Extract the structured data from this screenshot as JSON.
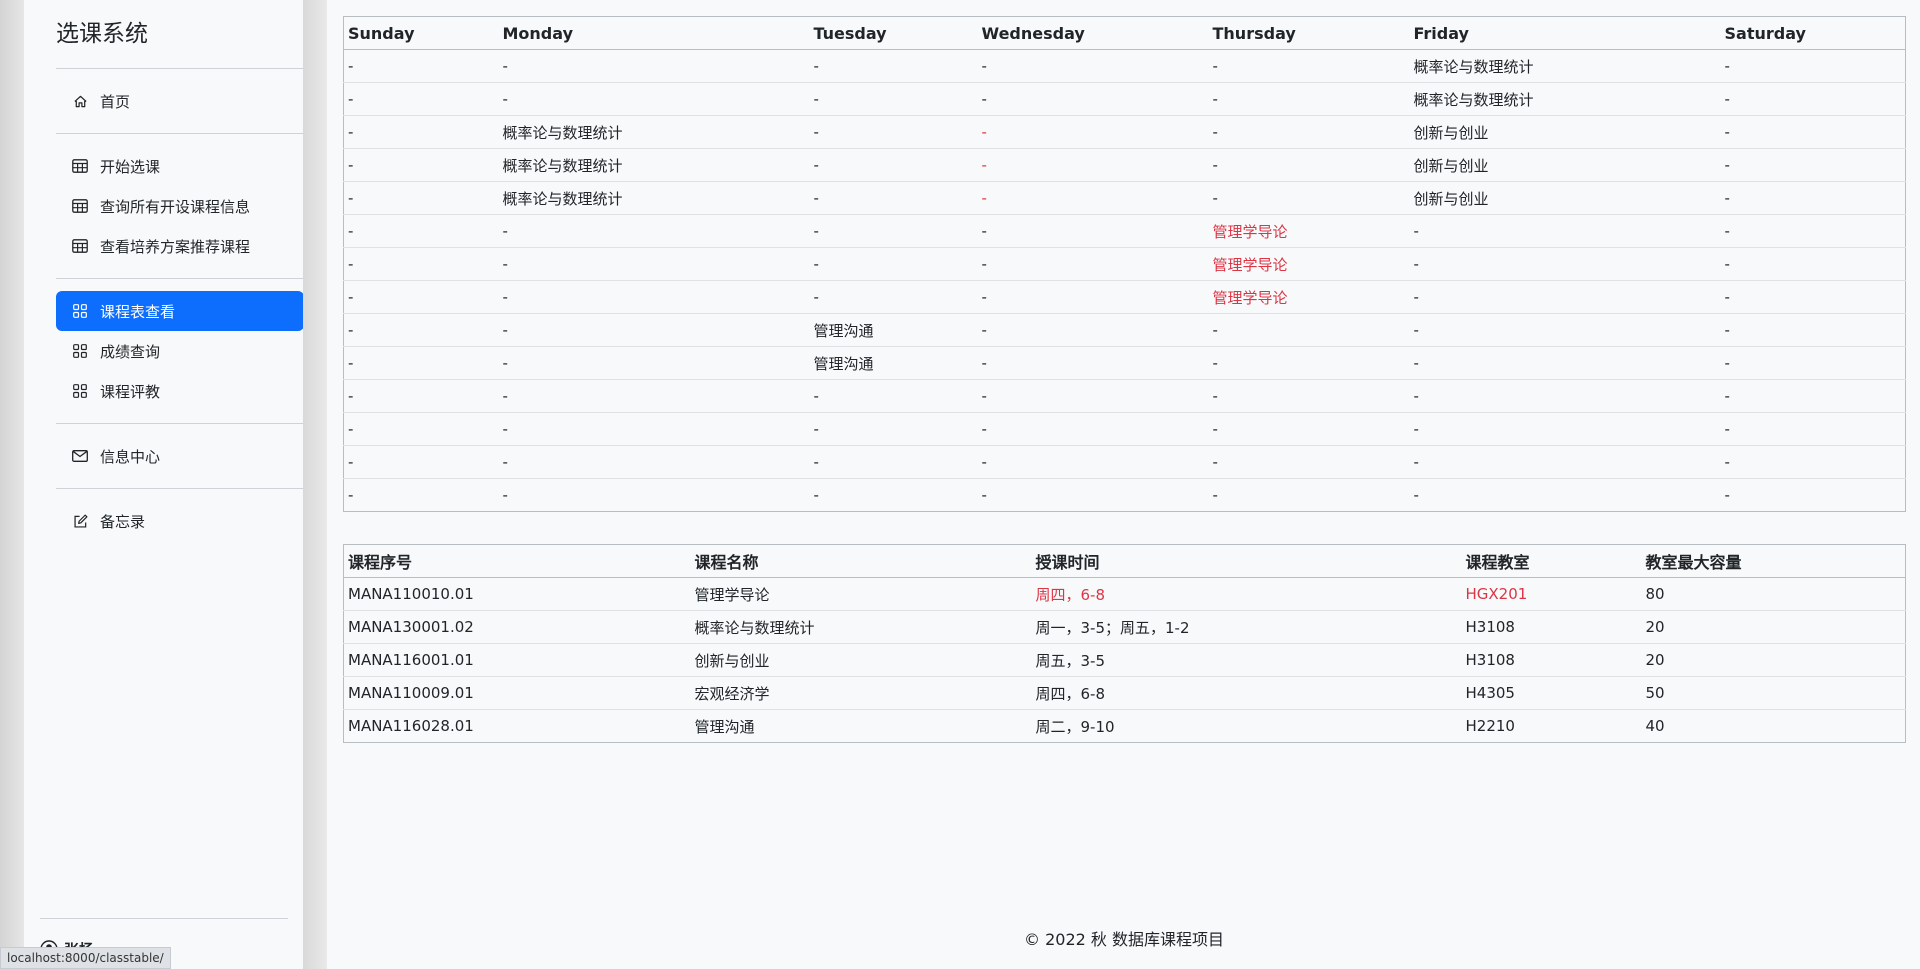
{
  "sidebar": {
    "brand": "选课系统",
    "group1": [
      {
        "label": "首页",
        "icon": "home-icon"
      }
    ],
    "group2": [
      {
        "label": "开始选课",
        "icon": "table-icon"
      },
      {
        "label": "查询所有开设课程信息",
        "icon": "table-icon"
      },
      {
        "label": "查看培养方案推荐课程",
        "icon": "table-icon"
      }
    ],
    "group3": [
      {
        "label": "课程表查看",
        "icon": "grid-icon",
        "active": true
      },
      {
        "label": "成绩查询",
        "icon": "grid-icon"
      },
      {
        "label": "课程评教",
        "icon": "grid-icon"
      }
    ],
    "group4": [
      {
        "label": "信息中心",
        "icon": "envelope-icon"
      }
    ],
    "group5": [
      {
        "label": "备忘录",
        "icon": "edit-icon"
      }
    ],
    "user": {
      "name": "张杨",
      "icon": "user-icon"
    }
  },
  "status_url": "localhost:8000/classtable/",
  "schedule": {
    "headers": [
      "Sunday",
      "Monday",
      "Tuesday",
      "Wednesday",
      "Thursday",
      "Friday",
      "Saturday"
    ],
    "rows": [
      [
        "-",
        "-",
        "-",
        "-",
        "-",
        "概率论与数理统计",
        "-"
      ],
      [
        "-",
        "-",
        "-",
        "-",
        "-",
        "概率论与数理统计",
        "-"
      ],
      [
        "-",
        "概率论与数理统计",
        "-",
        "-",
        "-",
        "创新与创业",
        "-"
      ],
      [
        "-",
        "概率论与数理统计",
        "-",
        "-",
        "-",
        "创新与创业",
        "-"
      ],
      [
        "-",
        "概率论与数理统计",
        "-",
        "-",
        "-",
        "创新与创业",
        "-"
      ],
      [
        "-",
        "-",
        "-",
        "-",
        "管理学导论",
        "-",
        "-"
      ],
      [
        "-",
        "-",
        "-",
        "-",
        "管理学导论",
        "-",
        "-"
      ],
      [
        "-",
        "-",
        "-",
        "-",
        "管理学导论",
        "-",
        "-"
      ],
      [
        "-",
        "-",
        "管理沟通",
        "-",
        "-",
        "-",
        "-"
      ],
      [
        "-",
        "-",
        "管理沟通",
        "-",
        "-",
        "-",
        "-"
      ],
      [
        "-",
        "-",
        "-",
        "-",
        "-",
        "-",
        "-"
      ],
      [
        "-",
        "-",
        "-",
        "-",
        "-",
        "-",
        "-"
      ],
      [
        "-",
        "-",
        "-",
        "-",
        "-",
        "-",
        "-"
      ],
      [
        "-",
        "-",
        "-",
        "-",
        "-",
        "-",
        "-"
      ]
    ],
    "red_cells": [
      [
        2,
        3
      ],
      [
        3,
        3
      ],
      [
        4,
        3
      ],
      [
        5,
        4
      ],
      [
        6,
        4
      ],
      [
        7,
        4
      ]
    ]
  },
  "courses": {
    "headers": [
      "课程序号",
      "课程名称",
      "授课时间",
      "课程教室",
      "教室最大容量"
    ],
    "rows": [
      [
        "MANA110010.01",
        "管理学导论",
        "周四，6-8",
        "HGX201",
        "80"
      ],
      [
        "MANA130001.02",
        "概率论与数理统计",
        "周一，3-5；周五，1-2",
        "H3108",
        "20"
      ],
      [
        "MANA116001.01",
        "创新与创业",
        "周五，3-5",
        "H3108",
        "20"
      ],
      [
        "MANA110009.01",
        "宏观经济学",
        "周四，6-8",
        "H4305",
        "50"
      ],
      [
        "MANA116028.01",
        "管理沟通",
        "周二，9-10",
        "H2210",
        "40"
      ]
    ],
    "red_cells": [
      [
        0,
        2
      ],
      [
        0,
        3
      ]
    ]
  },
  "footer": "© 2022 秋 数据库课程项目",
  "colors": {
    "accent": "#0d6efd",
    "conflict": "#dc3545"
  }
}
